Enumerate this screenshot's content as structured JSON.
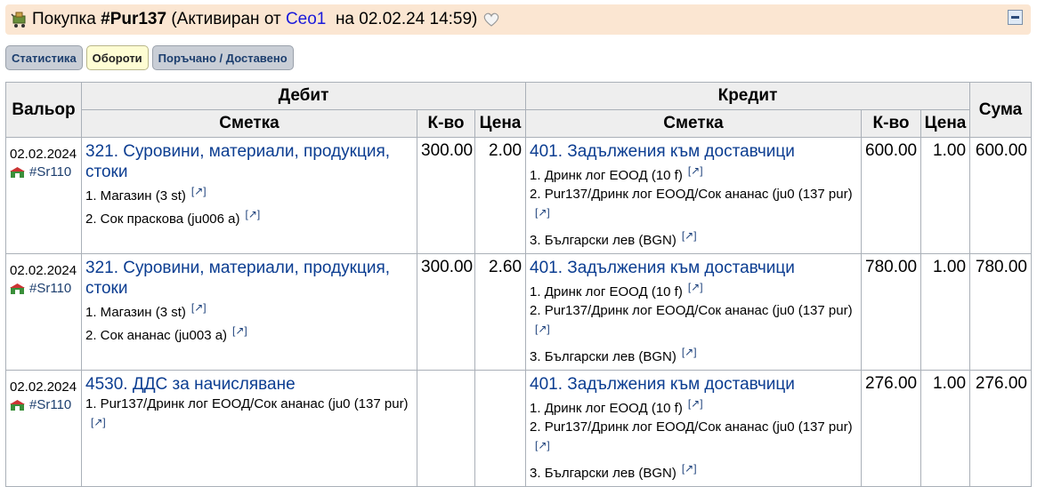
{
  "header": {
    "prefix": "Покупка",
    "doc_id": "#Pur137",
    "activated_text": "(Активиран от",
    "user": "Ceo1",
    "date_text": "на 02.02.24 14:59)"
  },
  "tabs": [
    {
      "label": "Статистика",
      "active": false
    },
    {
      "label": "Обороти",
      "active": true
    },
    {
      "label": "Поръчано / Доставено",
      "active": false
    }
  ],
  "table": {
    "h_valor": "Вальор",
    "h_debit": "Дебит",
    "h_credit": "Кредит",
    "h_account": "Сметка",
    "h_qty": "К-во",
    "h_price": "Цена",
    "h_sum": "Сума",
    "ext_link": "[↗]",
    "rows": [
      {
        "date": "02.02.2024",
        "ref": "#Sr110",
        "debit_account": "321. Суровини, материали, продукция, стоки",
        "debit_items": [
          "1. Магазин (3 st)",
          "2. Сок праскова (ju006 a)"
        ],
        "debit_qty": "300.00",
        "debit_price": "2.00",
        "credit_account": "401. Задължения към доставчици",
        "credit_items": [
          "1. Дринк лог ЕООД (10 f)",
          "2. Pur137/Дринк лог ЕООД/Сок ананас (ju0 (137 pur)",
          "3. Български лев (BGN)"
        ],
        "credit_qty": "600.00",
        "credit_price": "1.00",
        "sum": "600.00"
      },
      {
        "date": "02.02.2024",
        "ref": "#Sr110",
        "debit_account": "321. Суровини, материали, продукция, стоки",
        "debit_items": [
          "1. Магазин (3 st)",
          "2. Сок ананас (ju003 a)"
        ],
        "debit_qty": "300.00",
        "debit_price": "2.60",
        "credit_account": "401. Задължения към доставчици",
        "credit_items": [
          "1. Дринк лог ЕООД (10 f)",
          "2. Pur137/Дринк лог ЕООД/Сок ананас (ju0 (137 pur)",
          "3. Български лев (BGN)"
        ],
        "credit_qty": "780.00",
        "credit_price": "1.00",
        "sum": "780.00"
      },
      {
        "date": "02.02.2024",
        "ref": "#Sr110",
        "debit_account": "4530. ДДС за начисляване",
        "debit_items": [
          "1. Pur137/Дринк лог ЕООД/Сок ананас (ju0 (137 pur)"
        ],
        "debit_qty": "",
        "debit_price": "",
        "credit_account": "401. Задължения към доставчици",
        "credit_items": [
          "1. Дринк лог ЕООД (10 f)",
          "2. Pur137/Дринк лог ЕООД/Сок ананас (ju0 (137 pur)",
          "3. Български лев (BGN)"
        ],
        "credit_qty": "276.00",
        "credit_price": "1.00",
        "sum": "276.00"
      }
    ]
  }
}
